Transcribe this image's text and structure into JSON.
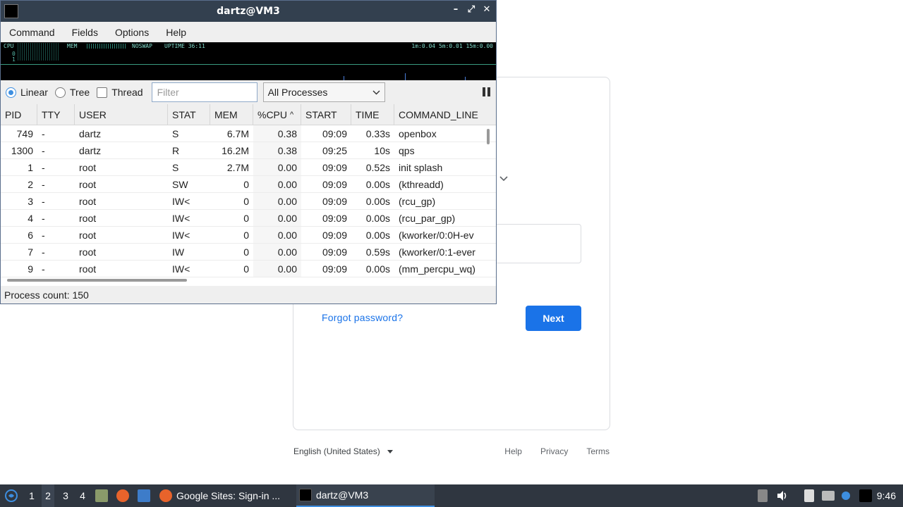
{
  "background_page": {
    "forgot_password": "Forgot password?",
    "next_button": "Next",
    "footer": {
      "language": "English (United States)",
      "help": "Help",
      "privacy": "Privacy",
      "terms": "Terms"
    }
  },
  "window": {
    "title": "dartz@VM3",
    "controls": {
      "minimize": "–",
      "maximize": "⤢",
      "close": "✕"
    },
    "menu": [
      "Command",
      "Fields",
      "Options",
      "Help"
    ],
    "graph": {
      "cpu": "CPU",
      "mem": "MEM",
      "swap": "NOSWAP",
      "uptime": "UPTIME 36:11",
      "load": "1m:0.04 5m:0.01 15m:0.00",
      "zero": "0",
      "one": "1"
    },
    "toolbar": {
      "linear": "Linear",
      "tree": "Tree",
      "thread": "Thread",
      "filter_placeholder": "Filter",
      "process_select": "All Processes",
      "view_mode": "Linear"
    },
    "columns": [
      "PID",
      "TTY",
      "USER",
      "STAT",
      "MEM",
      "%CPU",
      "START",
      "TIME",
      "COMMAND_LINE"
    ],
    "sort_column": "%CPU",
    "rows": [
      {
        "pid": "749",
        "tty": "-",
        "user": "dartz",
        "stat": "S",
        "mem": "6.7M",
        "cpu": "0.38",
        "start": "09:09",
        "time": "0.33s",
        "cmd": "openbox"
      },
      {
        "pid": "1300",
        "tty": "-",
        "user": "dartz",
        "stat": "R",
        "mem": "16.2M",
        "cpu": "0.38",
        "start": "09:25",
        "time": "10s",
        "cmd": "qps"
      },
      {
        "pid": "1",
        "tty": "-",
        "user": "root",
        "stat": "S",
        "mem": "2.7M",
        "cpu": "0.00",
        "start": "09:09",
        "time": "0.52s",
        "cmd": "init splash"
      },
      {
        "pid": "2",
        "tty": "-",
        "user": "root",
        "stat": "SW",
        "mem": "0",
        "cpu": "0.00",
        "start": "09:09",
        "time": "0.00s",
        "cmd": "(kthreadd)"
      },
      {
        "pid": "3",
        "tty": "-",
        "user": "root",
        "stat": "IW<",
        "mem": "0",
        "cpu": "0.00",
        "start": "09:09",
        "time": "0.00s",
        "cmd": "(rcu_gp)"
      },
      {
        "pid": "4",
        "tty": "-",
        "user": "root",
        "stat": "IW<",
        "mem": "0",
        "cpu": "0.00",
        "start": "09:09",
        "time": "0.00s",
        "cmd": "(rcu_par_gp)"
      },
      {
        "pid": "6",
        "tty": "-",
        "user": "root",
        "stat": "IW<",
        "mem": "0",
        "cpu": "0.00",
        "start": "09:09",
        "time": "0.00s",
        "cmd": "(kworker/0:0H-ev"
      },
      {
        "pid": "7",
        "tty": "-",
        "user": "root",
        "stat": "IW",
        "mem": "0",
        "cpu": "0.00",
        "start": "09:09",
        "time": "0.59s",
        "cmd": "(kworker/0:1-ever"
      },
      {
        "pid": "9",
        "tty": "-",
        "user": "root",
        "stat": "IW<",
        "mem": "0",
        "cpu": "0.00",
        "start": "09:09",
        "time": "0.00s",
        "cmd": "(mm_percpu_wq)"
      }
    ],
    "status": "Process count: 150"
  },
  "taskbar": {
    "desktops": [
      "1",
      "2",
      "3",
      "4"
    ],
    "active_desktop": "2",
    "tasks": [
      {
        "label": "Google Sites: Sign-in ...",
        "icon": "firefox-icon"
      },
      {
        "label": "dartz@VM3",
        "icon": "terminal-icon"
      }
    ],
    "clock": "9:46",
    "colors": {
      "accent": "#3d8ee0",
      "bar": "#2f3640",
      "google_blue": "#1a73e8"
    }
  }
}
